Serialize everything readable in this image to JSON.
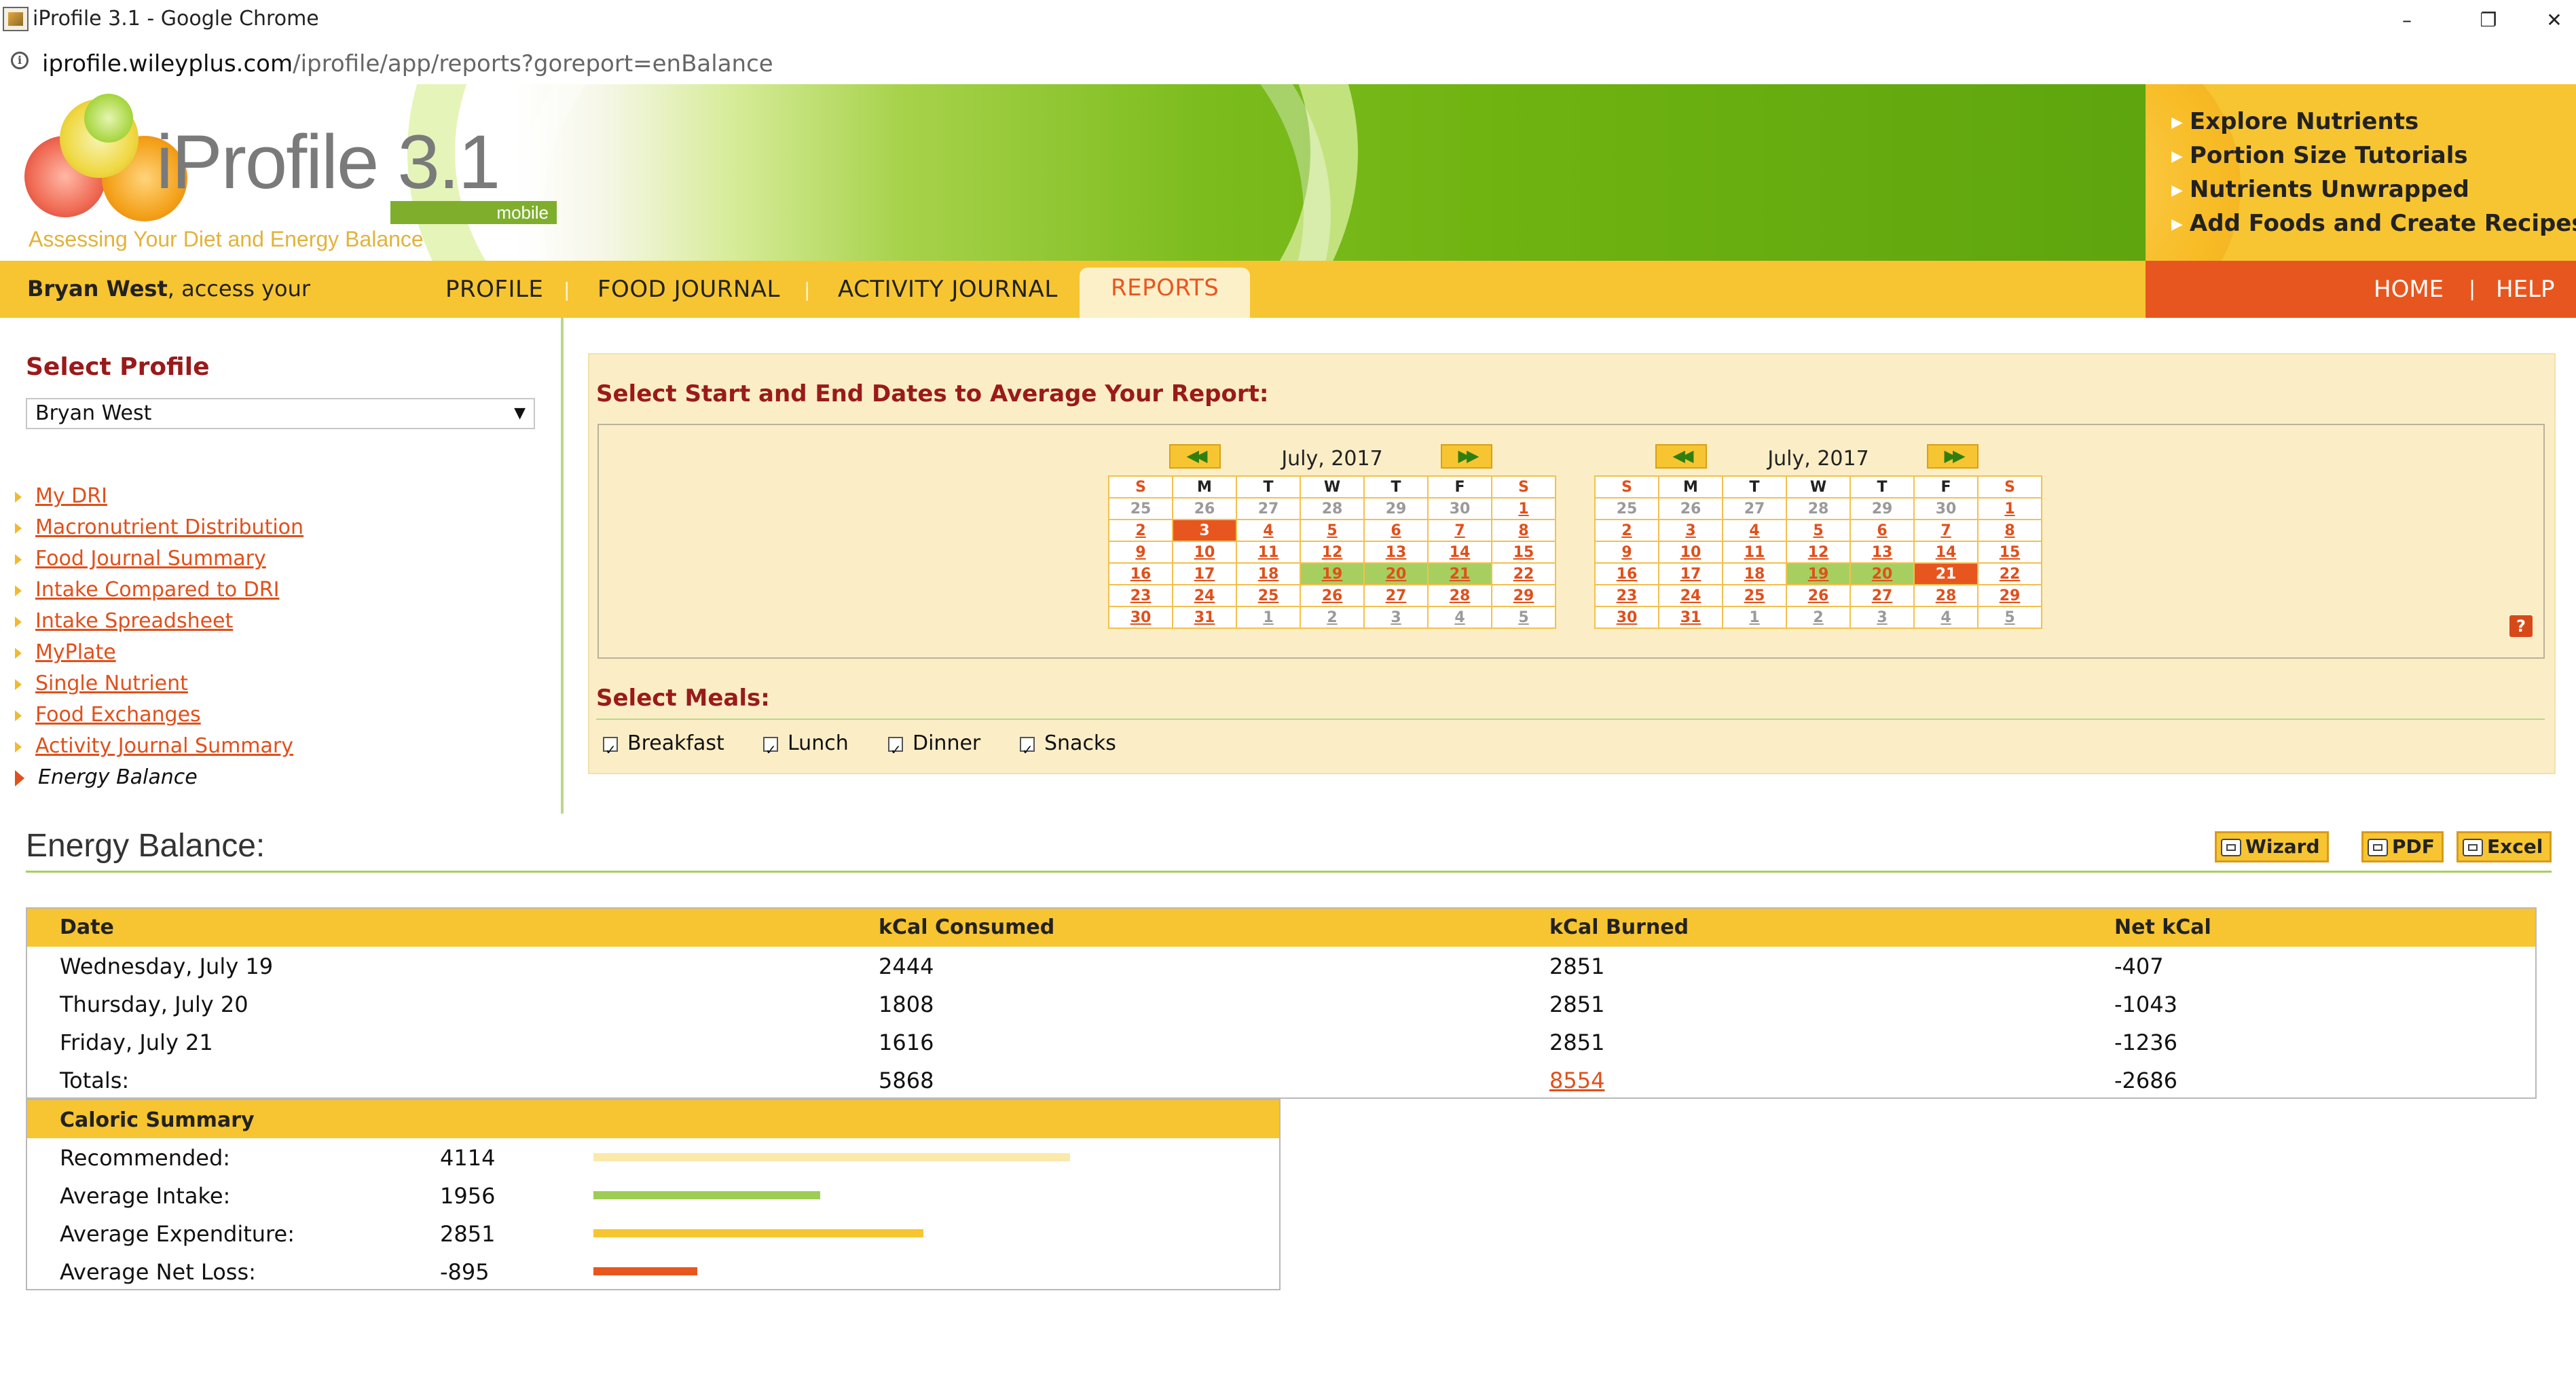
{
  "window": {
    "title": "iProfile 3.1 - Google Chrome",
    "controls": [
      "–",
      "❐",
      "✕"
    ]
  },
  "address": {
    "host": "iprofile.wileyplus.com",
    "path": "/iprofile/app/reports?goreport=enBalance"
  },
  "banner": {
    "logo": "iProfile 3.1",
    "mobile": "mobile",
    "tagline": "Assessing Your Diet and Energy Balance"
  },
  "quick_links": [
    "Explore Nutrients",
    "Portion Size Tutorials",
    "Nutrients Unwrapped",
    "Add Foods and Create Recipes"
  ],
  "nav": {
    "user_name": "Bryan West",
    "user_suffix": ", access your",
    "items": [
      "PROFILE",
      "FOOD JOURNAL",
      "ACTIVITY JOURNAL",
      "REPORTS"
    ],
    "active": "REPORTS",
    "right_items": [
      "HOME",
      "HELP"
    ]
  },
  "sidebar": {
    "heading": "Select Profile",
    "profile_value": "Bryan West",
    "reports": [
      "My DRI",
      "Macronutrient Distribution",
      "Food Journal Summary",
      "Intake Compared to DRI",
      "Intake Spreadsheet",
      "MyPlate",
      "Single Nutrient",
      "Food Exchanges",
      "Activity Journal Summary"
    ],
    "current_report": "Energy Balance"
  },
  "date_panel": {
    "heading": "Select Start and End Dates to Average Your Report:",
    "prev_label": "◀◀",
    "next_label": "▶▶",
    "help_label": "?",
    "weekdays": [
      "S",
      "M",
      "T",
      "W",
      "T",
      "F",
      "S"
    ],
    "calendars": [
      {
        "month": "July, 2017",
        "weeks": [
          [
            {
              "d": "25",
              "o": true
            },
            {
              "d": "26",
              "o": true
            },
            {
              "d": "27",
              "o": true
            },
            {
              "d": "28",
              "o": true
            },
            {
              "d": "29",
              "o": true
            },
            {
              "d": "30",
              "o": true
            },
            {
              "d": "1"
            }
          ],
          [
            {
              "d": "2"
            },
            {
              "d": "3",
              "s": true
            },
            {
              "d": "4"
            },
            {
              "d": "5"
            },
            {
              "d": "6"
            },
            {
              "d": "7"
            },
            {
              "d": "8"
            }
          ],
          [
            {
              "d": "9"
            },
            {
              "d": "10"
            },
            {
              "d": "11"
            },
            {
              "d": "12"
            },
            {
              "d": "13"
            },
            {
              "d": "14"
            },
            {
              "d": "15"
            }
          ],
          [
            {
              "d": "16"
            },
            {
              "d": "17"
            },
            {
              "d": "18"
            },
            {
              "d": "19",
              "r": true
            },
            {
              "d": "20",
              "r": true
            },
            {
              "d": "21",
              "r": true
            },
            {
              "d": "22"
            }
          ],
          [
            {
              "d": "23"
            },
            {
              "d": "24"
            },
            {
              "d": "25"
            },
            {
              "d": "26"
            },
            {
              "d": "27"
            },
            {
              "d": "28"
            },
            {
              "d": "29"
            }
          ],
          [
            {
              "d": "30"
            },
            {
              "d": "31"
            },
            {
              "d": "1",
              "o": true,
              "u": true
            },
            {
              "d": "2",
              "o": true,
              "u": true
            },
            {
              "d": "3",
              "o": true,
              "u": true
            },
            {
              "d": "4",
              "o": true,
              "u": true
            },
            {
              "d": "5",
              "o": true,
              "u": true
            }
          ]
        ]
      },
      {
        "month": "July, 2017",
        "weeks": [
          [
            {
              "d": "25",
              "o": true
            },
            {
              "d": "26",
              "o": true
            },
            {
              "d": "27",
              "o": true
            },
            {
              "d": "28",
              "o": true
            },
            {
              "d": "29",
              "o": true
            },
            {
              "d": "30",
              "o": true
            },
            {
              "d": "1"
            }
          ],
          [
            {
              "d": "2"
            },
            {
              "d": "3"
            },
            {
              "d": "4"
            },
            {
              "d": "5"
            },
            {
              "d": "6"
            },
            {
              "d": "7"
            },
            {
              "d": "8"
            }
          ],
          [
            {
              "d": "9"
            },
            {
              "d": "10"
            },
            {
              "d": "11"
            },
            {
              "d": "12"
            },
            {
              "d": "13"
            },
            {
              "d": "14"
            },
            {
              "d": "15"
            }
          ],
          [
            {
              "d": "16"
            },
            {
              "d": "17"
            },
            {
              "d": "18"
            },
            {
              "d": "19",
              "r": true
            },
            {
              "d": "20",
              "r": true
            },
            {
              "d": "21",
              "s": true
            },
            {
              "d": "22"
            }
          ],
          [
            {
              "d": "23"
            },
            {
              "d": "24"
            },
            {
              "d": "25"
            },
            {
              "d": "26"
            },
            {
              "d": "27"
            },
            {
              "d": "28"
            },
            {
              "d": "29"
            }
          ],
          [
            {
              "d": "30"
            },
            {
              "d": "31"
            },
            {
              "d": "1",
              "o": true,
              "u": true
            },
            {
              "d": "2",
              "o": true,
              "u": true
            },
            {
              "d": "3",
              "o": true,
              "u": true
            },
            {
              "d": "4",
              "o": true,
              "u": true
            },
            {
              "d": "5",
              "o": true,
              "u": true
            }
          ]
        ]
      }
    ],
    "meals_heading": "Select Meals:",
    "meals": [
      {
        "label": "Breakfast",
        "checked": true
      },
      {
        "label": "Lunch",
        "checked": true
      },
      {
        "label": "Dinner",
        "checked": true
      },
      {
        "label": "Snacks",
        "checked": true
      }
    ]
  },
  "energy_balance": {
    "title": "Energy Balance:",
    "buttons": [
      "Wizard",
      "PDF",
      "Excel"
    ],
    "columns": [
      "Date",
      "kCal Consumed",
      "kCal Burned",
      "Net kCal"
    ],
    "rows": [
      [
        "Wednesday, July 19",
        "2444",
        "2851",
        "-407"
      ],
      [
        "Thursday, July 20",
        "1808",
        "2851",
        "-1043"
      ],
      [
        "Friday, July 21",
        "1616",
        "2851",
        "-1236"
      ]
    ],
    "totals": [
      "Totals:",
      "5868",
      "8554",
      "-2686"
    ]
  },
  "caloric_summary": {
    "heading": "Caloric Summary",
    "rows": [
      {
        "label": "Recommended:",
        "value": "4114",
        "bar_value": 4114,
        "color": "#fbe9ac"
      },
      {
        "label": "Average Intake:",
        "value": "1956",
        "bar_value": 1956,
        "color": "#9dcd55"
      },
      {
        "label": "Average Expenditure:",
        "value": "2851",
        "bar_value": 2851,
        "color": "#f7c531"
      },
      {
        "label": "Average Net Loss:",
        "value": "-895",
        "bar_value": 895,
        "color": "#e8561f"
      }
    ]
  }
}
